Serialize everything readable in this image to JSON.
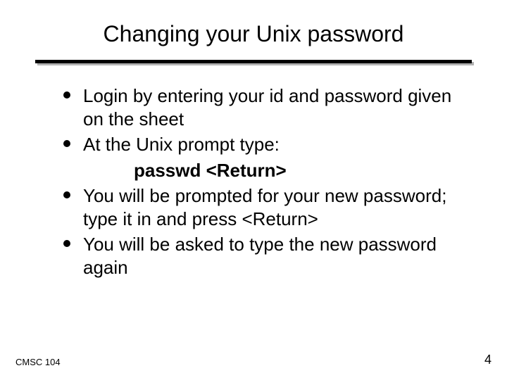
{
  "slide": {
    "title": "Changing your Unix password",
    "bullets": [
      {
        "text": "Login by entering your id and password given on the sheet",
        "sub": null
      },
      {
        "text": "At the Unix prompt type:",
        "sub": "passwd <Return>"
      },
      {
        "text": "You will be prompted for your new password; type it in and press <Return>",
        "sub": null
      },
      {
        "text": "You will be asked to type the new password again",
        "sub": null
      }
    ]
  },
  "footer": {
    "left": "CMSC 104",
    "right": "4"
  }
}
